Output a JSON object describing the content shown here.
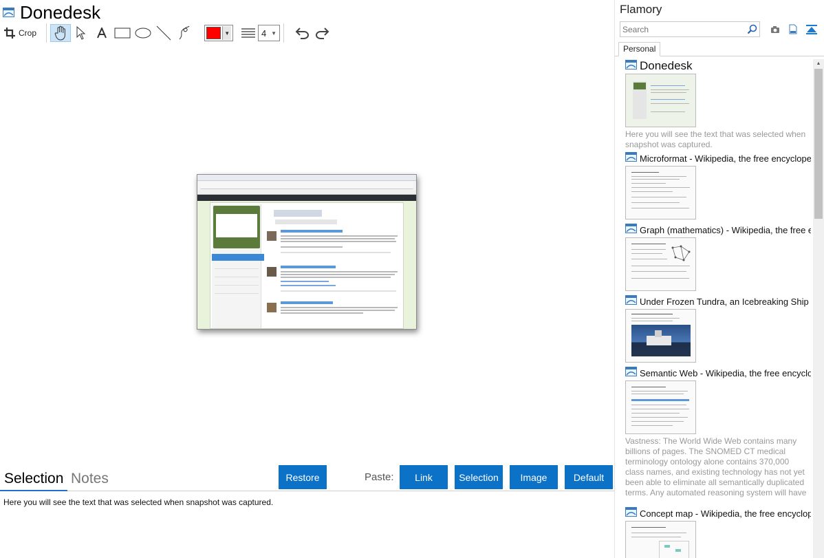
{
  "document": {
    "title": "Donedesk"
  },
  "toolbar": {
    "crop_label": "Crop",
    "color": "#ff0000",
    "line_width": "4"
  },
  "bottom": {
    "tabs": [
      "Selection",
      "Notes"
    ],
    "restore_label": "Restore",
    "paste_label": "Paste:",
    "paste_buttons": [
      "Link",
      "Selection",
      "Image",
      "Default"
    ],
    "selected_text": "Here you will see the text that was selected when snapshot was captured."
  },
  "sidebar": {
    "title": "Flamory",
    "search_placeholder": "Search",
    "tabs": [
      "Personal"
    ],
    "items": [
      {
        "title": "Donedesk",
        "snippet": "Here you will see the text that was selected when snapshot was captured."
      },
      {
        "title": "Microformat - Wikipedia, the free encyclopedia",
        "snippet": ""
      },
      {
        "title": "Graph (mathematics) - Wikipedia, the free encyclopedia",
        "snippet": ""
      },
      {
        "title": "Under Frozen Tundra, an Icebreaking Ship Uncovers",
        "snippet": ""
      },
      {
        "title": "Semantic Web - Wikipedia, the free encyclopedia",
        "snippet": "Vastness: The World Wide Web contains many billions of pages. The SNOMED CT medical terminology ontology alone contains 370,000 class names, and existing technology has not yet been able to eliminate all semantically duplicated terms. Any automated reasoning system will have to deal with truly huge inputs."
      },
      {
        "title": "Concept map - Wikipedia, the free encyclopedia",
        "snippet": ""
      }
    ]
  },
  "colors": {
    "accent": "#0b72c8",
    "tab_underline": "#1e6fc9",
    "hint_text": "#999999"
  }
}
